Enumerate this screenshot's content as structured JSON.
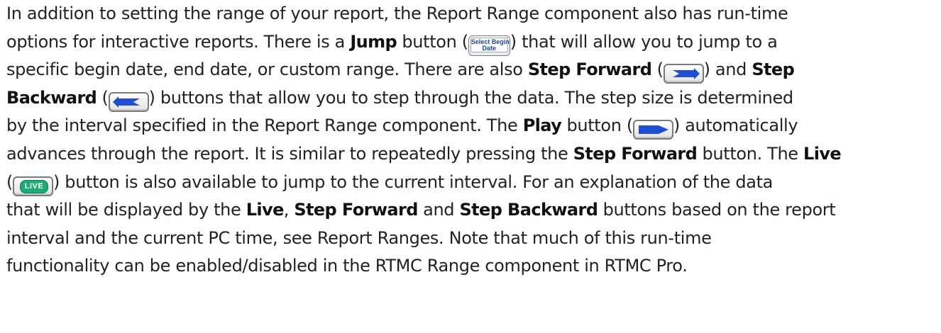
{
  "paragraph": {
    "l1": "In addition to setting the range of your report, the Report Range component also has run-time",
    "l2a": "options for interactive reports. There is a ",
    "jump": "Jump",
    "l2b": " button (",
    "l2c": ") that will allow you to jump to a",
    "l3a": "specific begin date, end date, or custom range. There are also ",
    "step_forward": "Step Forward",
    "l3b": " (",
    "l3c": ") and ",
    "step": "Step",
    "backward": "Backward",
    "l4a": " (",
    "l4b": ") buttons that allow you to step through the data. The step size is determined",
    "l5a": "by the interval specified in the Report Range component. The ",
    "play": "Play",
    "l5b": " button (",
    "l5c": ") automatically",
    "l6a": "advances through the report. It is similar to repeatedly pressing the ",
    "step_forward_2": "Step Forward",
    "l6b": " button. The ",
    "live": "Live",
    "l7a": " (",
    "l7b": ") button is also available to jump to the current interval. For an explanation of the data",
    "l8a": "that will be displayed by the ",
    "live_2": "Live",
    "l8b": ", ",
    "step_forward_3": "Step Forward",
    "l8c": " and ",
    "step_backward_3": "Step Backward",
    "l8d": " buttons based on the report",
    "l9": "interval and the current PC time, see Report Ranges. Note that much of this run-time",
    "l10": "functionality can be enabled/disabled in the RTMC Range component in RTMC Pro."
  },
  "icons": {
    "jump_line1": "Select Begin",
    "jump_line2": "Date",
    "live_label": "LIVE",
    "jump_icon": "select-begin-date-button-icon",
    "step_forward_icon": "step-forward-arrow-icon",
    "step_backward_icon": "step-backward-arrow-icon",
    "play_icon": "play-triangle-icon",
    "live_icon": "live-button-icon",
    "accent_blue": "#1f4fd0",
    "live_green": "#1eaa74"
  }
}
